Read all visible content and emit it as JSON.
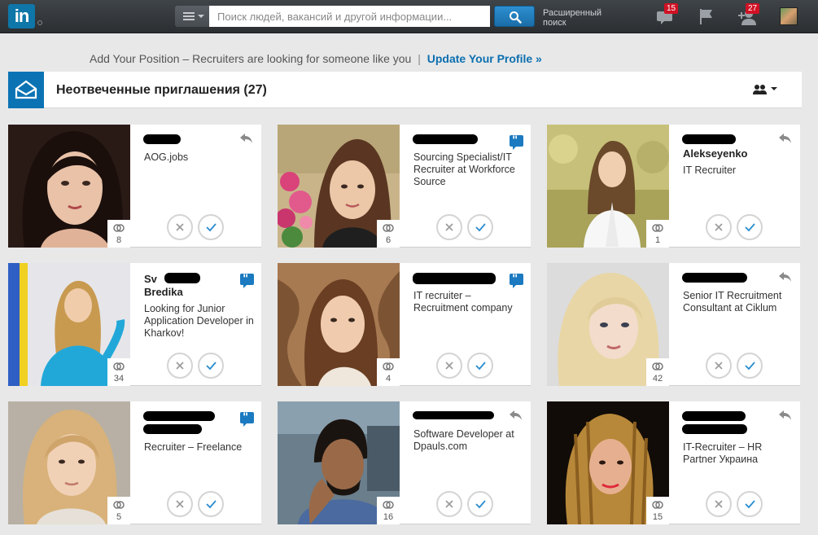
{
  "nav": {
    "logo_text": "in",
    "search_placeholder": "Поиск людей, вакансий и другой информации...",
    "advanced_search": "Расширенный поиск",
    "messages_badge": "15",
    "invites_badge": "27"
  },
  "banner": {
    "text": "Add Your Position – Recruiters are looking for someone like you",
    "separator": "|",
    "link": "Update Your Profile »"
  },
  "section": {
    "title": "Неотвеченные приглашения (27)"
  },
  "colors": {
    "brand": "#0e76a8",
    "link": "#0b6fb0",
    "badge": "#d11124"
  },
  "cards": [
    {
      "name_visible": "",
      "title": "AOG.jobs",
      "connections": "8",
      "icon": "reply-icon"
    },
    {
      "name_visible": "",
      "title": "Sourcing Specialist/IT Recruiter at Workforce Source",
      "connections": "6",
      "icon": "message-icon"
    },
    {
      "name_visible": "Alekseyenko",
      "title": "IT Recruiter",
      "connections": "1",
      "icon": "reply-icon"
    },
    {
      "name_visible": "Sv",
      "name_visible_2": "Bredika",
      "title": "Looking for Junior Application Developer in Kharkov!",
      "connections": "34",
      "icon": "message-icon"
    },
    {
      "name_visible": "",
      "title": "IT recruiter – Recruitment company",
      "connections": "4",
      "icon": "message-icon"
    },
    {
      "name_visible": "",
      "title": "Senior IT Recruitment Consultant at Ciklum",
      "connections": "42",
      "icon": "reply-icon"
    },
    {
      "name_visible": "",
      "title": "Recruiter – Freelance",
      "connections": "5",
      "icon": "message-icon"
    },
    {
      "name_visible": "",
      "title": "Software Developer at Dpauls.com",
      "connections": "16",
      "icon": "reply-icon"
    },
    {
      "name_visible": "",
      "title": "IT-Recruiter – HR Partner Украина",
      "connections": "15",
      "icon": "reply-icon"
    }
  ]
}
